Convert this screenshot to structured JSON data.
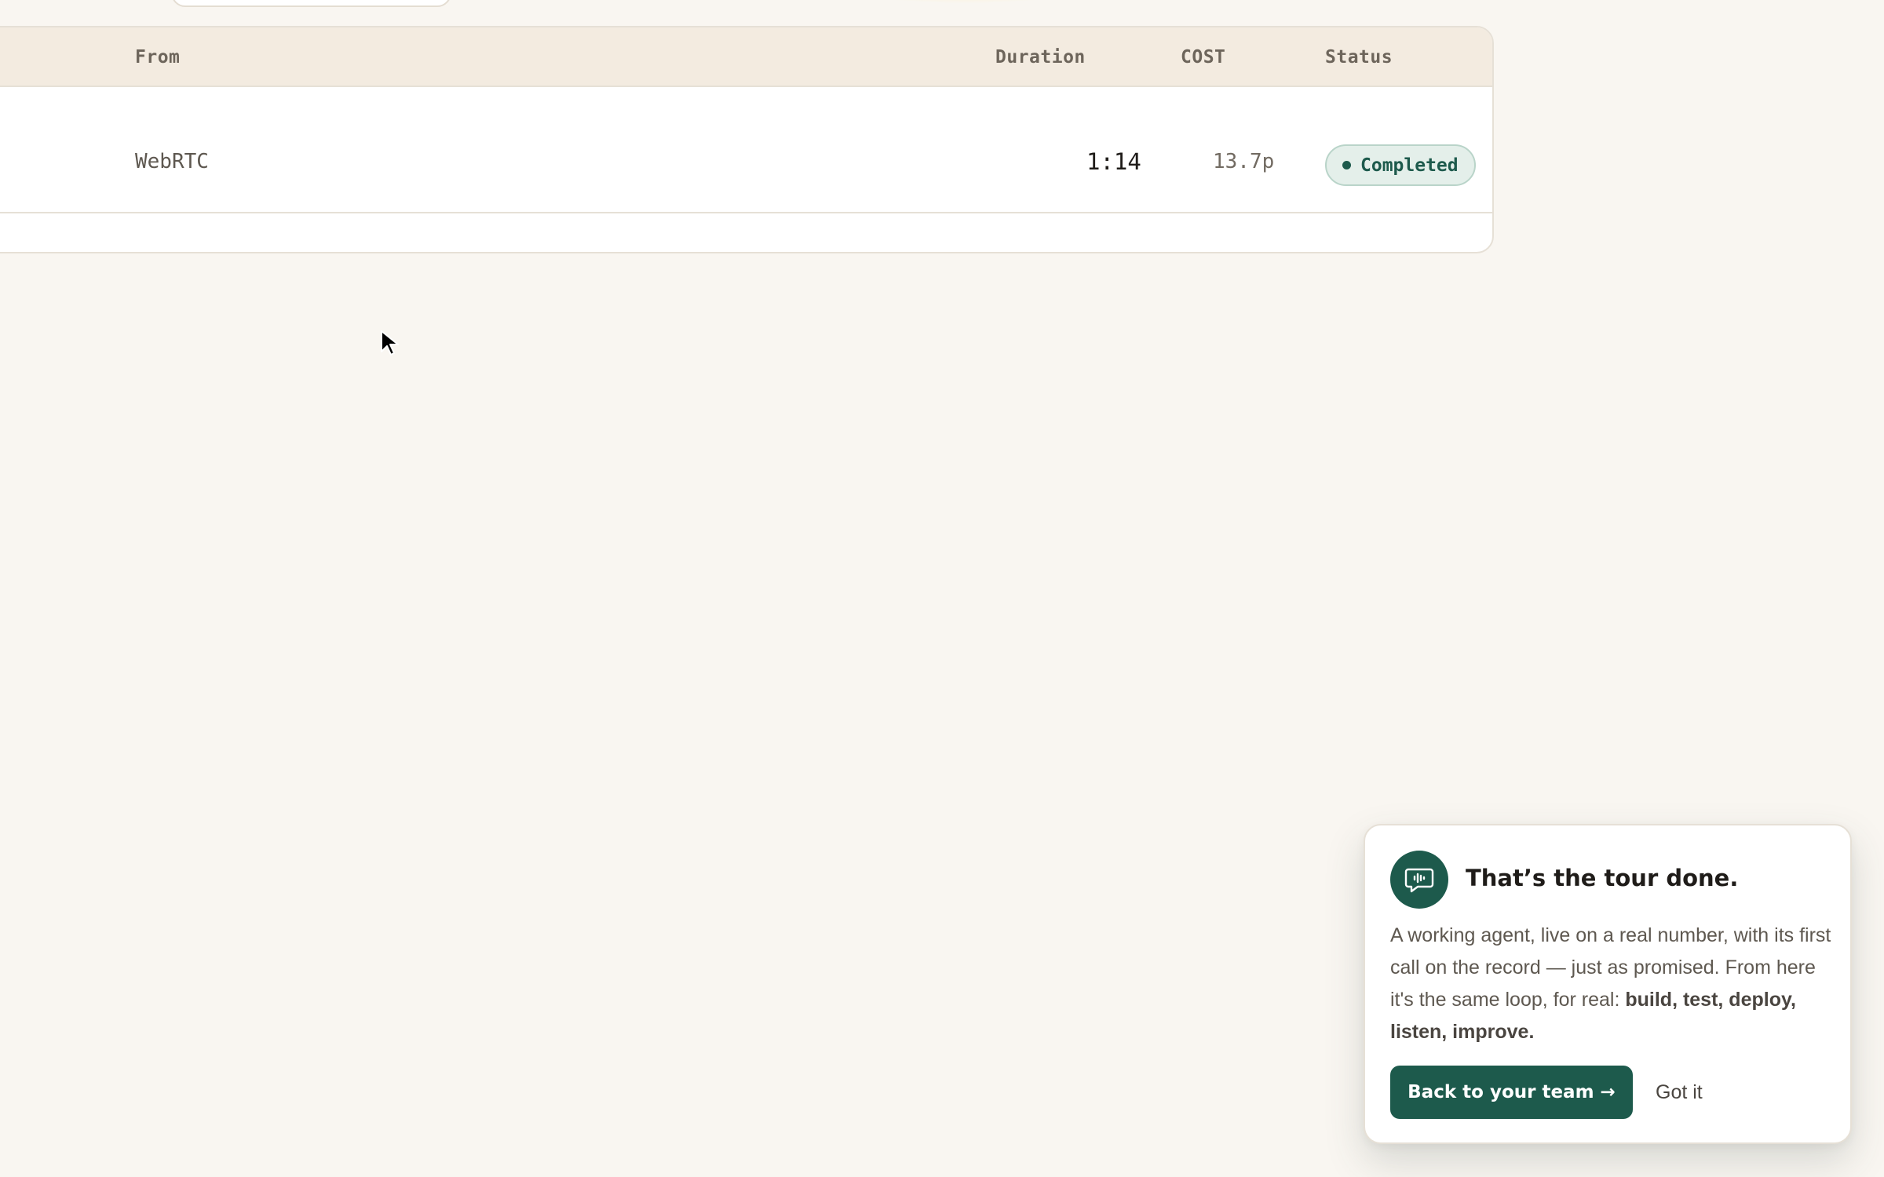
{
  "table": {
    "headers": {
      "from": "From",
      "duration": "Duration",
      "cost": "COST",
      "status": "Status"
    },
    "rows": [
      {
        "from": "WebRTC",
        "duration": "1:14",
        "cost": "13.7p",
        "status": "Completed"
      }
    ],
    "status_color": "#1d5a4c"
  },
  "tour": {
    "icon": "chat-waveform-icon",
    "title": "That’s the tour done.",
    "body_intro": "A working agent, live on a real number, with its first call on the record — just as promised. From here it's the same loop, for real: ",
    "body_bold": "build, test, deploy, listen, improve.",
    "primary_label": "Back to your team →",
    "secondary_label": "Got it",
    "accent": "#1d5a4c"
  },
  "colors": {
    "background": "#f9f6f1",
    "header_bg": "#f3ebe0"
  }
}
